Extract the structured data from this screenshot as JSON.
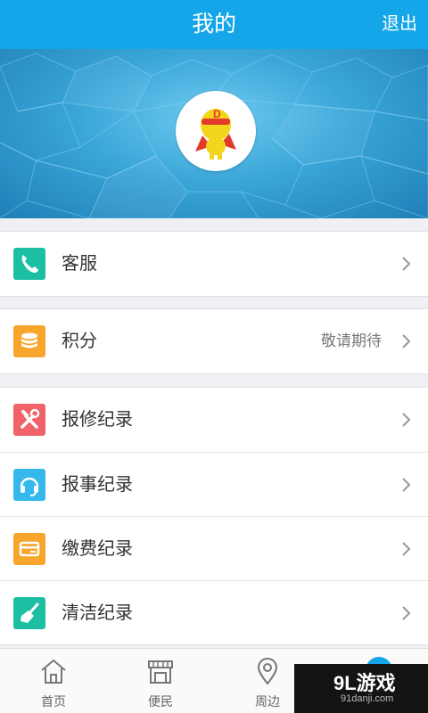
{
  "header": {
    "title": "我的",
    "logout_label": "退出"
  },
  "menu": {
    "group1": [
      {
        "label": "客服",
        "detail": "",
        "icon": "phone-icon",
        "color": "#1dbfa3"
      }
    ],
    "group2": [
      {
        "label": "积分",
        "detail": "敬请期待",
        "icon": "coins-icon",
        "color": "#f7a52b"
      }
    ],
    "group3": [
      {
        "label": "报修纪录",
        "detail": "",
        "icon": "tools-icon",
        "color": "#f2626a"
      },
      {
        "label": "报事纪录",
        "detail": "",
        "icon": "headset-icon",
        "color": "#35b8ec"
      },
      {
        "label": "缴费纪录",
        "detail": "",
        "icon": "card-icon",
        "color": "#f7a52b"
      },
      {
        "label": "清洁纪录",
        "detail": "",
        "icon": "broom-icon",
        "color": "#1dbfa3"
      }
    ]
  },
  "tabbar": [
    {
      "label": "首页",
      "icon": "home-icon"
    },
    {
      "label": "便民",
      "icon": "store-icon"
    },
    {
      "label": "周边",
      "icon": "location-pin-icon"
    }
  ],
  "watermark": {
    "text": "9L游戏",
    "url": "91danji.com"
  }
}
